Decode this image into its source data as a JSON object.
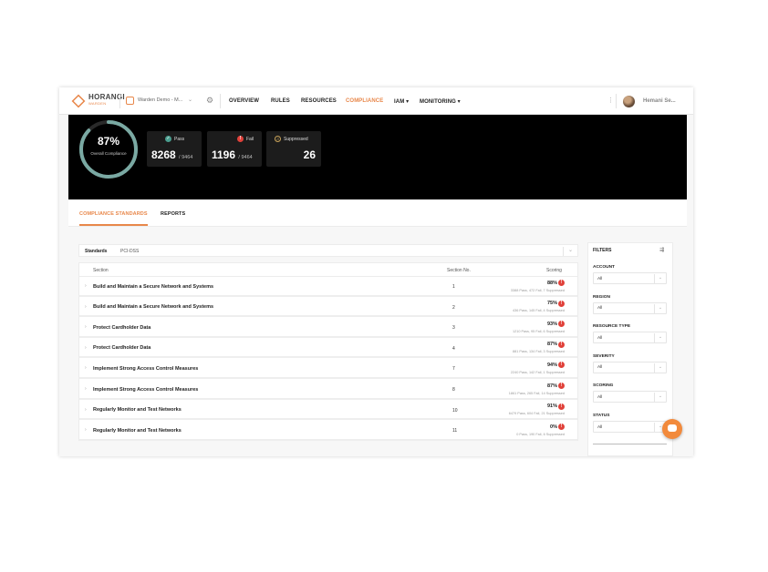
{
  "app": {
    "brand": "HORANGI",
    "brand_sub": "WARDEN",
    "workspace": "Warden Demo - M...",
    "user_name": "Hemani Se..."
  },
  "nav": {
    "items": [
      {
        "label": "OVERVIEW",
        "active": false
      },
      {
        "label": "RULES",
        "active": false
      },
      {
        "label": "RESOURCES",
        "active": false
      },
      {
        "label": "COMPLIANCE",
        "active": true
      },
      {
        "label": "IAM ▾",
        "active": false
      },
      {
        "label": "MONITORING ▾",
        "active": false
      }
    ]
  },
  "summary": {
    "compliance_pct": "87%",
    "compliance_label": "Overall Compliance",
    "compliance_value": 0.87,
    "pass": {
      "label": "Pass",
      "value": "8268",
      "total": "/ 9464"
    },
    "fail": {
      "label": "Fail",
      "value": "1196",
      "total": "/ 9464"
    },
    "suppressed": {
      "label": "Suppressed",
      "value": "26"
    }
  },
  "tabs": [
    {
      "label": "COMPLIANCE STANDARDS",
      "active": true
    },
    {
      "label": "REPORTS",
      "active": false
    }
  ],
  "standards": {
    "label": "Standards",
    "value": "PCI-DSS"
  },
  "table": {
    "columns": {
      "section": "Section",
      "section_no": "Section No.",
      "scoring": "Scoring"
    },
    "rows": [
      {
        "name": "Build and Maintain a Secure Network and Systems",
        "no": "1",
        "pct": "88%",
        "detail": "3388 Pass, 472 Fail, 7 Suppressed"
      },
      {
        "name": "Build and Maintain a Secure Network and Systems",
        "no": "2",
        "pct": "75%",
        "detail": "436 Pass, 145 Fail, 4 Suppressed"
      },
      {
        "name": "Protect Cardholder Data",
        "no": "3",
        "pct": "93%",
        "detail": "1210 Pass, 95 Fail, 6 Suppressed"
      },
      {
        "name": "Protect Cardholder Data",
        "no": "4",
        "pct": "87%",
        "detail": "881 Pass, 134 Fail, 3 Suppressed"
      },
      {
        "name": "Implement Strong Access Control Measures",
        "no": "7",
        "pct": "94%",
        "detail": "2240 Pass, 142 Fail, 1 Suppressed"
      },
      {
        "name": "Implement Strong Access Control Measures",
        "no": "8",
        "pct": "87%",
        "detail": "1861 Pass, 265 Fail, 14 Suppressed"
      },
      {
        "name": "Regularly Monitor and Test Networks",
        "no": "10",
        "pct": "91%",
        "detail": "6479 Pass, 604 Fail, 21 Suppressed"
      },
      {
        "name": "Regularly Monitor and Test Networks",
        "no": "11",
        "pct": "0%",
        "detail": "0 Pass, 190 Fail, 6 Suppressed"
      }
    ]
  },
  "filters": {
    "title": "FILTERS",
    "groups": [
      {
        "label": "ACCOUNT",
        "value": "All"
      },
      {
        "label": "REGION",
        "value": "All"
      },
      {
        "label": "RESOURCE TYPE",
        "value": "All"
      },
      {
        "label": "SEVERITY",
        "value": "All"
      },
      {
        "label": "SCORING",
        "value": "All"
      },
      {
        "label": "STATUS",
        "value": "All"
      }
    ]
  },
  "colors": {
    "accent": "#e8874a",
    "pass": "#4a9e8f",
    "fail": "#e0413a",
    "ring": "#7aa9a3"
  }
}
